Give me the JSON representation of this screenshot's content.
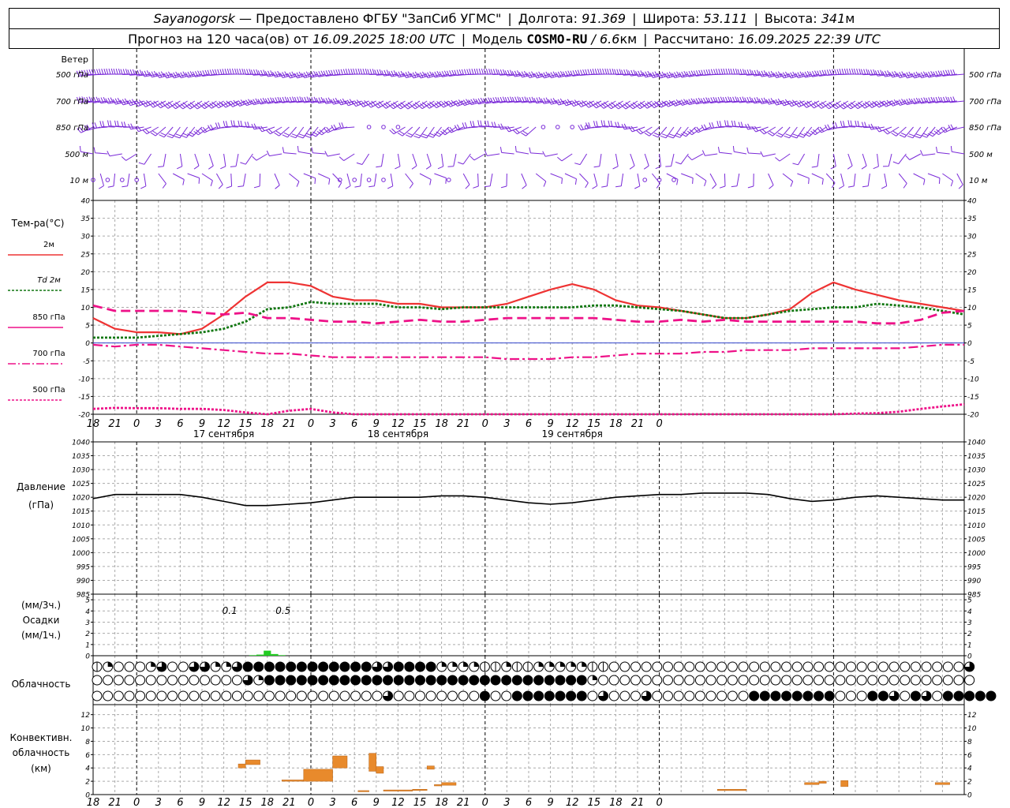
{
  "header": {
    "station": "Sayanogorsk",
    "provider": "— Предоставлено ФГБУ \"ЗапСиб УГМС\"",
    "lon_label": "Долгота:",
    "lon_value": "91.369",
    "lat_label": "Широта:",
    "lat_value": "53.111",
    "alt_label": "Высота:",
    "alt_value": "341",
    "alt_unit": "м",
    "forecast_label": "Прогноз на 120 часа(ов) от",
    "forecast_from": "16.09.2025 18:00 UTC",
    "model_label": "Модель",
    "model_name": "COSMO-RU",
    "model_res": "/ 6.6",
    "model_res_unit": "км",
    "calc_label": "Рассчитано:",
    "calc_time": "16.09.2025 22:39 UTC"
  },
  "wind_panel": {
    "title": "Ветер",
    "levels": [
      "500 гПа",
      "700 гПа",
      "850 гПа",
      "500 м",
      "10 м"
    ]
  },
  "temp_panel": {
    "title": "Тем-ра(°C)",
    "legend": [
      {
        "label": "2м",
        "color": "#ee3333",
        "dash": ""
      },
      {
        "label": "Td 2м",
        "color": "#117711",
        "dash": "3,2"
      },
      {
        "label": "850 гПа",
        "color": "#ee1188",
        "dash": ""
      },
      {
        "label": "700 гПа",
        "color": "#ee1188",
        "dash": "10,3,2,3"
      },
      {
        "label": "500 гПа",
        "color": "#ee1188",
        "dash": "3,2"
      }
    ],
    "ticks": [
      "40",
      "35",
      "30",
      "25",
      "20",
      "15",
      "10",
      "5",
      "0",
      "-5",
      "-10",
      "-15",
      "-20"
    ]
  },
  "time_axis": {
    "hours": [
      "18",
      "21",
      "0",
      "3",
      "6",
      "9",
      "12",
      "15",
      "18",
      "21",
      "0",
      "3",
      "6",
      "9",
      "12",
      "15",
      "18",
      "21",
      "0",
      "3",
      "6",
      "9",
      "12",
      "15",
      "18",
      "21",
      "0"
    ],
    "dates": [
      "17 сентября",
      "18 сентября",
      "19 сентября"
    ]
  },
  "pressure_panel": {
    "title": "Давление",
    "unit": "(гПа)",
    "ticks": [
      "1040",
      "1035",
      "1030",
      "1025",
      "1020",
      "1015",
      "1010",
      "1005",
      "1000",
      "995",
      "990",
      "985"
    ]
  },
  "precip_panel": {
    "unit_top": "(мм/3ч.)",
    "title": "Осадки",
    "unit_bottom": "(мм/1ч.)",
    "ticks": [
      "5",
      "4",
      "3",
      "2",
      "1",
      "0"
    ],
    "totals": [
      {
        "hour": 21,
        "text": "0.1"
      },
      {
        "hour": 24,
        "text": "0.5"
      }
    ]
  },
  "cloud_panel": {
    "title": "Облачность"
  },
  "conv_panel": {
    "title1": "Конвективн.",
    "title2": "облачность",
    "unit": "(км)",
    "ticks": [
      "12",
      "10",
      "8",
      "6",
      "4",
      "2",
      "0"
    ]
  },
  "chart_data": [
    {
      "type": "line",
      "title": "Тем-ра(°C)",
      "x_unit": "hours from 16.09.2025 18:00 UTC",
      "ylim": [
        -20,
        40
      ],
      "series": [
        {
          "name": "2м",
          "x": [
            0,
            3,
            6,
            9,
            12,
            15,
            18,
            21,
            24,
            27,
            30,
            33,
            36,
            39,
            42,
            45,
            48,
            51,
            54,
            57,
            60,
            63,
            66,
            69,
            72,
            75,
            78,
            81,
            84,
            87,
            90,
            93,
            96,
            99,
            102,
            105,
            108,
            111,
            114,
            117,
            120
          ],
          "y": [
            7,
            4,
            3,
            3,
            2.5,
            4,
            8,
            13,
            17,
            17,
            16,
            13,
            12,
            12,
            11,
            11,
            10,
            10,
            10,
            11,
            13,
            15,
            16.5,
            15,
            12,
            10.5,
            10,
            9,
            8,
            7,
            7,
            8,
            9.5,
            14,
            17,
            15,
            13.5,
            12,
            11,
            10,
            9
          ]
        },
        {
          "name": "Td 2м",
          "x": [
            0,
            3,
            6,
            9,
            12,
            15,
            18,
            21,
            24,
            27,
            30,
            33,
            36,
            39,
            42,
            45,
            48,
            51,
            54,
            57,
            60,
            63,
            66,
            69,
            72,
            75,
            78,
            81,
            84,
            87,
            90,
            93,
            96,
            99,
            102,
            105,
            108,
            111,
            114,
            117,
            120
          ],
          "y": [
            1.5,
            1.5,
            1.5,
            2,
            2.5,
            3,
            4,
            6,
            9.5,
            10,
            11.5,
            11,
            11,
            11,
            10,
            10,
            9.5,
            10,
            10,
            10,
            10,
            10,
            10,
            10.5,
            10.5,
            10,
            9.5,
            9,
            8,
            7,
            7,
            8,
            9,
            9.5,
            10,
            10,
            11,
            10.5,
            10,
            9,
            8
          ]
        },
        {
          "name": "850 гПа",
          "x": [
            0,
            3,
            6,
            9,
            12,
            15,
            18,
            21,
            24,
            27,
            30,
            33,
            36,
            39,
            42,
            45,
            48,
            51,
            54,
            57,
            60,
            63,
            66,
            69,
            72,
            75,
            78,
            81,
            84,
            87,
            90,
            93,
            96,
            99,
            102,
            105,
            108,
            111,
            114,
            117,
            120
          ],
          "y": [
            10.5,
            9,
            9,
            9,
            9,
            8.5,
            8,
            8.5,
            7,
            7,
            6.5,
            6,
            6,
            5.5,
            6,
            6.5,
            6,
            6,
            6.5,
            7,
            7,
            7,
            7,
            7,
            6.5,
            6,
            6,
            6.5,
            6,
            6.5,
            6,
            6,
            6,
            6,
            6,
            6,
            5.5,
            5.5,
            6.5,
            8.5,
            9
          ]
        },
        {
          "name": "700 гПа",
          "x": [
            0,
            3,
            6,
            9,
            12,
            15,
            18,
            21,
            24,
            27,
            30,
            33,
            36,
            39,
            42,
            45,
            48,
            51,
            54,
            57,
            60,
            63,
            66,
            69,
            72,
            75,
            78,
            81,
            84,
            87,
            90,
            93,
            96,
            99,
            102,
            105,
            108,
            111,
            114,
            117,
            120
          ],
          "y": [
            -0.5,
            -1,
            -0.5,
            -0.5,
            -1,
            -1.5,
            -2,
            -2.5,
            -3,
            -3,
            -3.5,
            -4,
            -4,
            -4,
            -4,
            -4,
            -4,
            -4,
            -4,
            -4.5,
            -4.5,
            -4.5,
            -4,
            -4,
            -3.5,
            -3,
            -3,
            -3,
            -2.5,
            -2.5,
            -2,
            -2,
            -2,
            -1.5,
            -1.5,
            -1.5,
            -1.5,
            -1.5,
            -1,
            -0.5,
            -0.5
          ]
        },
        {
          "name": "500 гПа",
          "x": [
            0,
            3,
            6,
            9,
            12,
            15,
            18,
            21,
            24,
            27,
            30,
            33,
            36,
            39,
            42,
            45,
            48,
            51,
            54,
            57,
            60,
            63,
            66,
            69,
            72,
            75,
            78,
            81,
            84,
            87,
            90,
            93,
            96,
            99,
            102,
            105,
            108,
            111,
            114,
            117,
            120
          ],
          "y": [
            -18.5,
            -18.2,
            -18.3,
            -18.3,
            -18.5,
            -18.5,
            -18.8,
            -19.5,
            -20,
            -19,
            -18.5,
            -19.5,
            -20.5,
            -21,
            -20,
            -20,
            -21,
            -21,
            -21,
            -21,
            -20.5,
            -20,
            -20.5,
            -21,
            -20,
            -20,
            -20,
            -20,
            -20,
            -20,
            -20,
            -20,
            -20,
            -20,
            -20,
            -19.8,
            -19.7,
            -19.3,
            -18.5,
            -17.8,
            -17.2
          ]
        }
      ]
    },
    {
      "type": "line",
      "title": "Давление (гПа)",
      "x_unit": "hours from 16.09.2025 18:00 UTC",
      "ylim": [
        985,
        1040
      ],
      "series": [
        {
          "name": "",
          "x": [
            0,
            3,
            6,
            9,
            12,
            15,
            18,
            21,
            24,
            27,
            30,
            33,
            36,
            39,
            42,
            45,
            48,
            51,
            54,
            57,
            60,
            63,
            66,
            69,
            72,
            75,
            78,
            81,
            84,
            87,
            90,
            93,
            96,
            99,
            102,
            105,
            108,
            111,
            114,
            117,
            120
          ],
          "y": [
            1019.5,
            1021,
            1021,
            1021,
            1021,
            1020,
            1018.5,
            1017,
            1017,
            1017.5,
            1018,
            1019,
            1020,
            1020,
            1020,
            1020,
            1020.5,
            1020.5,
            1020,
            1019,
            1018,
            1017.5,
            1018,
            1019,
            1020,
            1020.5,
            1021,
            1021,
            1021.5,
            1021.5,
            1021.5,
            1021,
            1019.5,
            1018.5,
            1019,
            1020,
            1020.5,
            1020,
            1019.5,
            1019,
            1019
          ]
        }
      ]
    },
    {
      "type": "bar",
      "title": "Осадки (мм/1ч.)",
      "ylim": [
        0,
        5
      ],
      "x": [
        22,
        23,
        24,
        25,
        26
      ],
      "values": [
        0.05,
        0.1,
        0.45,
        0.15,
        0.05
      ]
    },
    {
      "type": "bar",
      "title": "Конвективн. облачность (км)",
      "ylim": [
        0,
        13
      ],
      "ranges_km": [
        {
          "x0": 20,
          "x1": 21,
          "base": 4,
          "top": 4.6
        },
        {
          "x0": 21,
          "x1": 23,
          "base": 4.5,
          "top": 5.2
        },
        {
          "x0": 26,
          "x1": 29,
          "base": 2,
          "top": 2.2
        },
        {
          "x0": 29,
          "x1": 33,
          "base": 2,
          "top": 3.8
        },
        {
          "x0": 33,
          "x1": 35,
          "base": 4,
          "top": 5.8
        },
        {
          "x0": 36.5,
          "x1": 38,
          "base": 0.5,
          "top": 0.6
        },
        {
          "x0": 38,
          "x1": 39,
          "base": 3.5,
          "top": 6.2
        },
        {
          "x0": 39,
          "x1": 40,
          "base": 3.2,
          "top": 4.2
        },
        {
          "x0": 40,
          "x1": 44,
          "base": 0.6,
          "top": 0.7
        },
        {
          "x0": 44,
          "x1": 46,
          "base": 0.7,
          "top": 0.8
        },
        {
          "x0": 46,
          "x1": 47,
          "base": 3.8,
          "top": 4.3
        },
        {
          "x0": 47,
          "x1": 48,
          "base": 1.3,
          "top": 1.5
        },
        {
          "x0": 48,
          "x1": 50,
          "base": 1.4,
          "top": 1.8
        },
        {
          "x0": 86,
          "x1": 90,
          "base": 0.6,
          "top": 0.8
        },
        {
          "x0": 98,
          "x1": 100,
          "base": 1.5,
          "top": 1.8
        },
        {
          "x0": 100,
          "x1": 101,
          "base": 1.7,
          "top": 2
        },
        {
          "x0": 103,
          "x1": 104,
          "base": 1.2,
          "top": 2.1
        },
        {
          "x0": 116,
          "x1": 118,
          "base": 1.5,
          "top": 1.8
        }
      ]
    }
  ],
  "clouds": {
    "rows": [
      [
        1,
        2,
        0,
        0,
        0,
        2,
        3,
        0,
        0,
        3,
        3,
        2,
        2,
        3,
        4,
        4,
        4,
        4,
        4,
        4,
        4,
        4,
        4,
        4,
        4,
        4,
        3,
        3,
        4,
        4,
        4,
        4,
        2,
        2,
        2,
        2,
        1,
        1,
        2,
        1,
        1,
        2,
        2,
        2,
        2,
        2,
        1,
        1,
        0,
        0,
        0,
        0,
        0,
        0,
        0,
        0,
        0,
        0,
        0,
        0,
        0,
        0,
        0,
        0,
        0,
        0,
        0,
        0,
        0,
        0,
        0,
        0,
        0,
        0,
        0,
        0,
        0,
        0,
        0,
        0,
        0,
        3
      ],
      [
        0,
        0,
        0,
        0,
        0,
        0,
        0,
        0,
        0,
        0,
        0,
        0,
        0,
        0,
        3,
        2,
        4,
        4,
        4,
        4,
        4,
        4,
        4,
        4,
        4,
        4,
        4,
        4,
        4,
        4,
        4,
        4,
        4,
        4,
        4,
        4,
        4,
        4,
        4,
        4,
        4,
        4,
        4,
        4,
        4,
        4,
        2,
        0,
        0,
        0,
        0,
        0,
        0,
        0,
        0,
        0,
        0,
        0,
        0,
        0,
        0,
        0,
        0,
        0,
        0,
        0,
        0,
        0,
        0,
        0,
        0,
        0,
        0,
        0,
        0,
        0,
        0,
        0,
        0,
        0,
        0,
        0
      ],
      [
        0,
        0,
        0,
        0,
        0,
        0,
        0,
        0,
        0,
        0,
        0,
        0,
        0,
        0,
        0,
        0,
        0,
        0,
        0,
        0,
        0,
        0,
        0,
        0,
        0,
        0,
        0,
        3,
        0,
        0,
        0,
        0,
        0,
        0,
        0,
        0,
        4,
        0,
        0,
        4,
        4,
        4,
        4,
        4,
        4,
        4,
        0,
        3,
        0,
        0,
        0,
        3,
        0,
        0,
        0,
        0,
        0,
        0,
        0,
        0,
        0,
        4,
        4,
        4,
        4,
        4,
        4,
        4,
        4,
        0,
        0,
        0,
        4,
        4,
        3,
        0,
        4,
        3,
        0,
        4,
        4,
        4,
        4,
        4
      ]
    ]
  }
}
